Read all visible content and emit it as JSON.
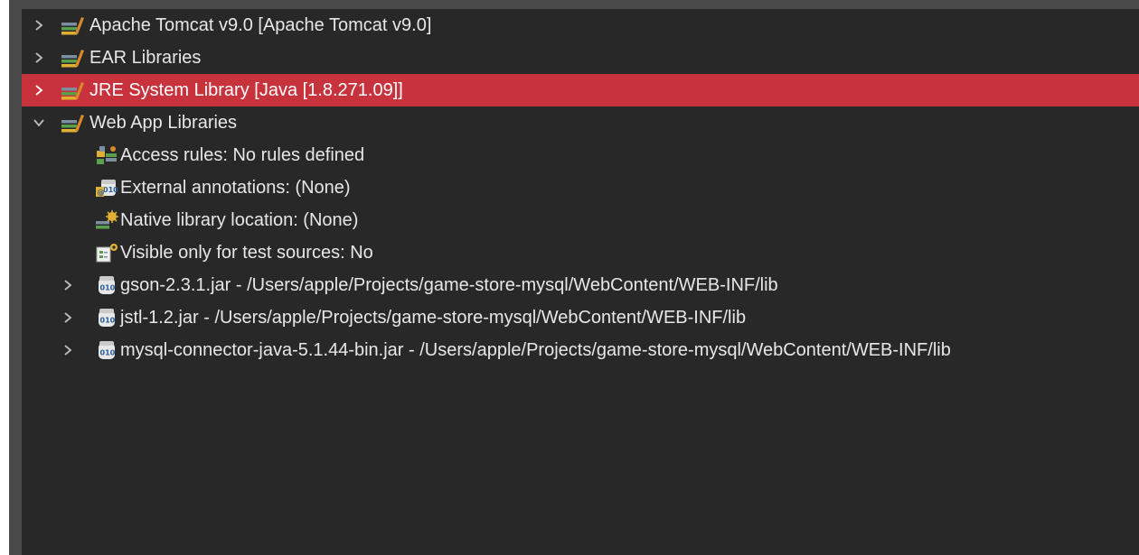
{
  "tree": {
    "items": [
      {
        "label": "Apache Tomcat v9.0 [Apache Tomcat v9.0]",
        "icon": "library-icon",
        "state": "collapsed"
      },
      {
        "label": "EAR Libraries",
        "icon": "library-icon",
        "state": "collapsed"
      },
      {
        "label": "JRE System Library [Java [1.8.271.09]]",
        "icon": "library-icon",
        "state": "collapsed",
        "selected": true
      },
      {
        "label": "Web App Libraries",
        "icon": "library-icon",
        "state": "expanded"
      },
      {
        "label": "Access rules: No rules defined",
        "icon": "access-rules-icon"
      },
      {
        "label": "External annotations: (None)",
        "icon": "external-annotations-icon"
      },
      {
        "label": "Native library location: (None)",
        "icon": "native-library-icon"
      },
      {
        "label": "Visible only for test sources: No",
        "icon": "test-sources-icon"
      },
      {
        "label": "gson-2.3.1.jar - /Users/apple/Projects/game-store-mysql/WebContent/WEB-INF/lib",
        "icon": "jar-icon",
        "state": "collapsed"
      },
      {
        "label": "jstl-1.2.jar - /Users/apple/Projects/game-store-mysql/WebContent/WEB-INF/lib",
        "icon": "jar-icon",
        "state": "collapsed"
      },
      {
        "label": "mysql-connector-java-5.1.44-bin.jar - /Users/apple/Projects/game-store-mysql/WebContent/WEB-INF/lib",
        "icon": "jar-icon",
        "state": "collapsed"
      }
    ]
  },
  "colors": {
    "background": "#282828",
    "selection": "#c8323c",
    "text": "#e7e7e7"
  }
}
